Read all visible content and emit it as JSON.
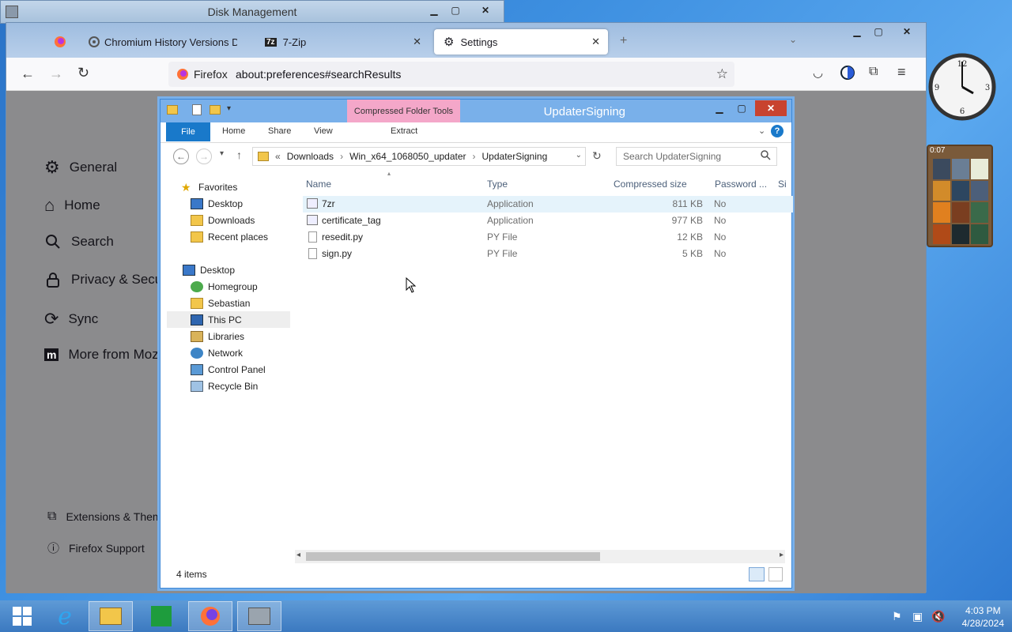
{
  "disk_management": {
    "title": "Disk Management"
  },
  "firefox": {
    "tabs": [
      {
        "label": ""
      },
      {
        "label": "Chromium History Versions Do"
      },
      {
        "label": "7-Zip"
      },
      {
        "label": "Settings"
      }
    ],
    "url_brand": "Firefox",
    "url": "about:preferences#searchResults",
    "sidebar": {
      "items": [
        {
          "label": "General",
          "icon": "gear-icon"
        },
        {
          "label": "Home",
          "icon": "home-icon"
        },
        {
          "label": "Search",
          "icon": "search-icon"
        },
        {
          "label": "Privacy & Securi",
          "icon": "lock-icon"
        },
        {
          "label": "Sync",
          "icon": "sync-icon"
        },
        {
          "label": "More from Moz",
          "icon": "mozilla-icon"
        }
      ],
      "footer": [
        {
          "label": "Extensions & Them",
          "icon": "puzzle-icon"
        },
        {
          "label": "Firefox Support",
          "icon": "help-icon"
        }
      ]
    }
  },
  "explorer": {
    "context_tab": "Compressed Folder Tools",
    "title": "UpdaterSigning",
    "ribbon": {
      "file": "File",
      "home": "Home",
      "share": "Share",
      "view": "View",
      "extract": "Extract"
    },
    "address": {
      "prefix": "«",
      "crumbs": [
        "Downloads",
        "Win_x64_1068050_updater",
        "UpdaterSigning"
      ]
    },
    "search_placeholder": "Search UpdaterSigning",
    "nav": {
      "favorites": "Favorites",
      "fav_items": [
        "Desktop",
        "Downloads",
        "Recent places"
      ],
      "desktop": "Desktop",
      "desktop_items": [
        "Homegroup",
        "Sebastian",
        "This PC",
        "Libraries",
        "Network",
        "Control Panel",
        "Recycle Bin"
      ]
    },
    "columns": [
      "Name",
      "Type",
      "Compressed size",
      "Password ...",
      "Si"
    ],
    "files": [
      {
        "name": "7zr",
        "type": "Application",
        "size": "811 KB",
        "password": "No"
      },
      {
        "name": "certificate_tag",
        "type": "Application",
        "size": "977 KB",
        "password": "No"
      },
      {
        "name": "resedit.py",
        "type": "PY File",
        "size": "12 KB",
        "password": "No"
      },
      {
        "name": "sign.py",
        "type": "PY File",
        "size": "5 KB",
        "password": "No"
      }
    ],
    "status": "4 items"
  },
  "taskbar": {
    "time": "4:03 PM",
    "date": "4/28/2024"
  },
  "gadget": {
    "timer": "0:07"
  },
  "colors": {
    "accent": "#1979ca",
    "context_tab": "#f4a7c9",
    "title_bar": "#79b0ea"
  }
}
